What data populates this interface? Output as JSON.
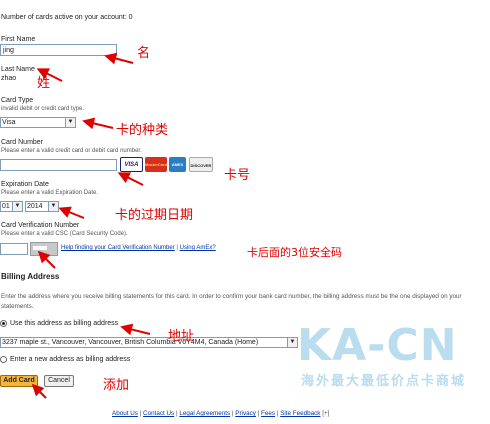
{
  "cards_active": "Number of cards active on your account: 0",
  "first_name": {
    "label": "First Name",
    "value": "jing"
  },
  "last_name": {
    "label": "Last Name",
    "value": "zhao"
  },
  "card_type": {
    "label": "Card Type",
    "error": "invalid debit or credit card type.",
    "value": "Visa"
  },
  "card_number": {
    "label": "Card Number",
    "error": "Please enter a valid credit card or debit card number.",
    "value": ""
  },
  "card_logos": [
    "VISA",
    "MasterCard",
    "AMEX",
    "DISCOVER"
  ],
  "expiration": {
    "label": "Expiration Date",
    "error": "Please enter a valid Expiration Date.",
    "month": "01",
    "year": "2014"
  },
  "cvn": {
    "label": "Card Verification Number",
    "error": "Please enter a valid CSC (Card Security Code).",
    "value": "",
    "help_link": "Help finding your Card Verification Number",
    "separator": "|",
    "amex_link": "Using AmEx?"
  },
  "billing": {
    "heading": "Billing Address",
    "description": "Enter the address where you receive billing statements for this card. In order to confirm your bank card number, the billing address must be the one displayed on your statements.",
    "use_this_label": "Use this address as billing address",
    "address_value": "3237   maple   st., Vancouver, Vancouver, British Columbia V6Y4M4, Canada (Home)",
    "enter_new_label": "Enter a new address as billing address"
  },
  "buttons": {
    "add_card": "Add Card",
    "cancel": "Cancel"
  },
  "footer": {
    "links": [
      "About Us",
      "Contact Us",
      "Legal Agreements",
      "Privacy",
      "Fees",
      "Site Feedback"
    ],
    "separator": "|",
    "end_mark": "[+]"
  },
  "annotations": {
    "first_name": "名",
    "last_name": "姓",
    "card_type": "卡的种类",
    "card_number": "卡号",
    "expiration": "卡的过期日期",
    "cvn": "卡后面的3位安全码",
    "address": "地址",
    "add": "添加"
  },
  "watermark": {
    "title": "KA-CN",
    "subtitle": "海外最大最低价点卡商城"
  },
  "colors": {
    "annotation_red": "#e00000",
    "link_blue": "#0033aa",
    "watermark": "#b9dcef",
    "add_button": "#f5b53b"
  }
}
